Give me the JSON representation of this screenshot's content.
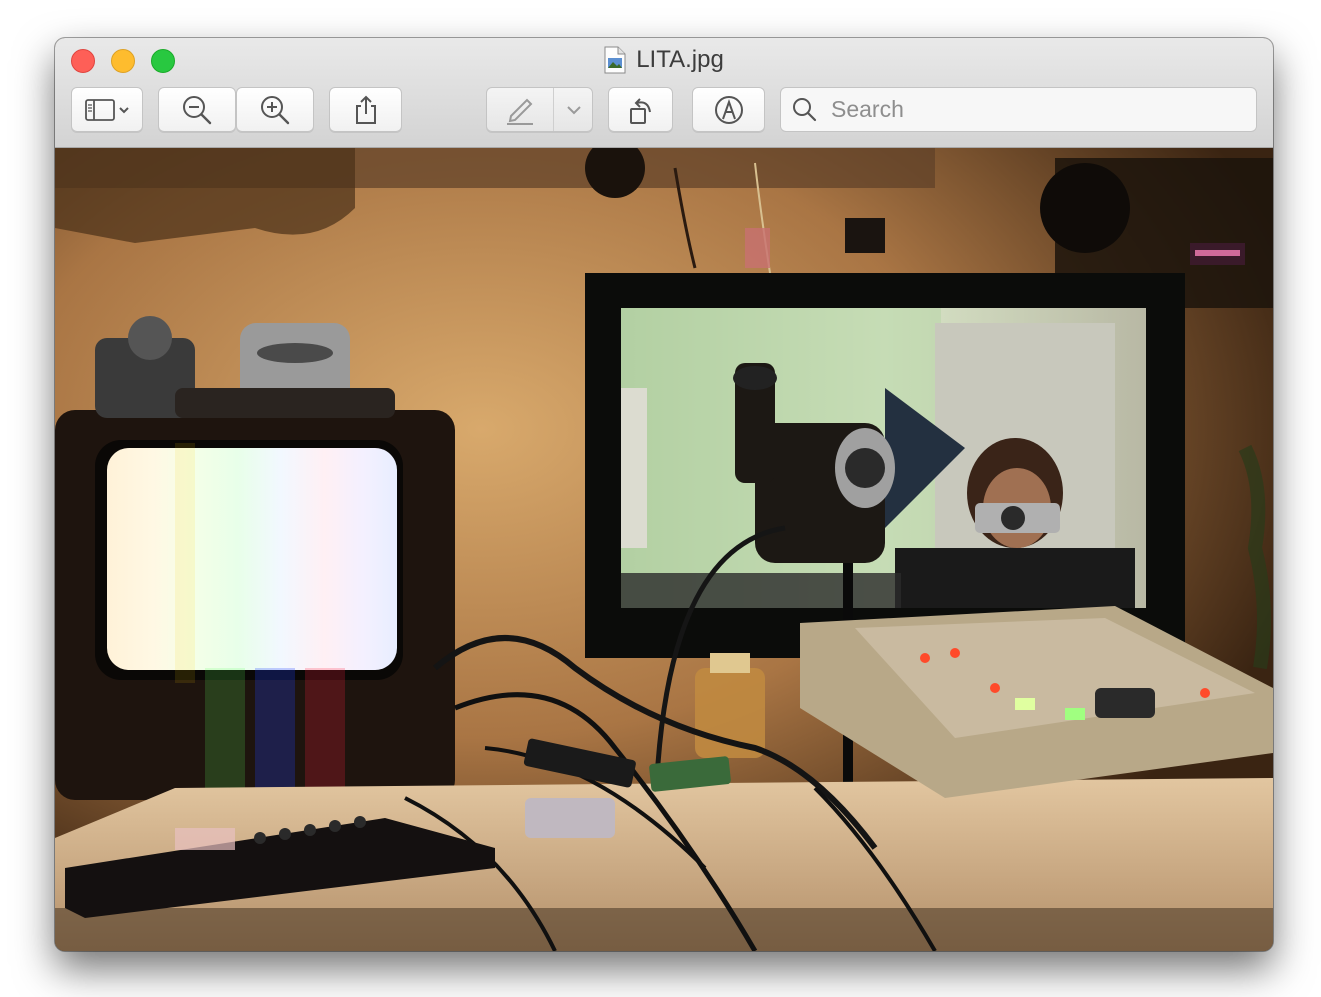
{
  "window": {
    "title": "LITA.jpg",
    "file_icon": "jpeg-document-icon"
  },
  "toolbar": {
    "buttons": [
      {
        "name": "sidebar-toggle",
        "icon": "sidebar-icon"
      },
      {
        "name": "zoom-out",
        "icon": "zoom-out-icon"
      },
      {
        "name": "zoom-in",
        "icon": "zoom-in-icon"
      },
      {
        "name": "share",
        "icon": "share-icon"
      },
      {
        "name": "markup",
        "icon": "pen-icon"
      },
      {
        "name": "rotate",
        "icon": "rotate-left-icon"
      },
      {
        "name": "markup-toolbar",
        "icon": "markup-circle-icon"
      }
    ],
    "search": {
      "placeholder": "Search",
      "value": ""
    }
  },
  "colors": {
    "close": "#fe5f57",
    "minimize": "#febc2e",
    "maximize": "#28c840"
  }
}
